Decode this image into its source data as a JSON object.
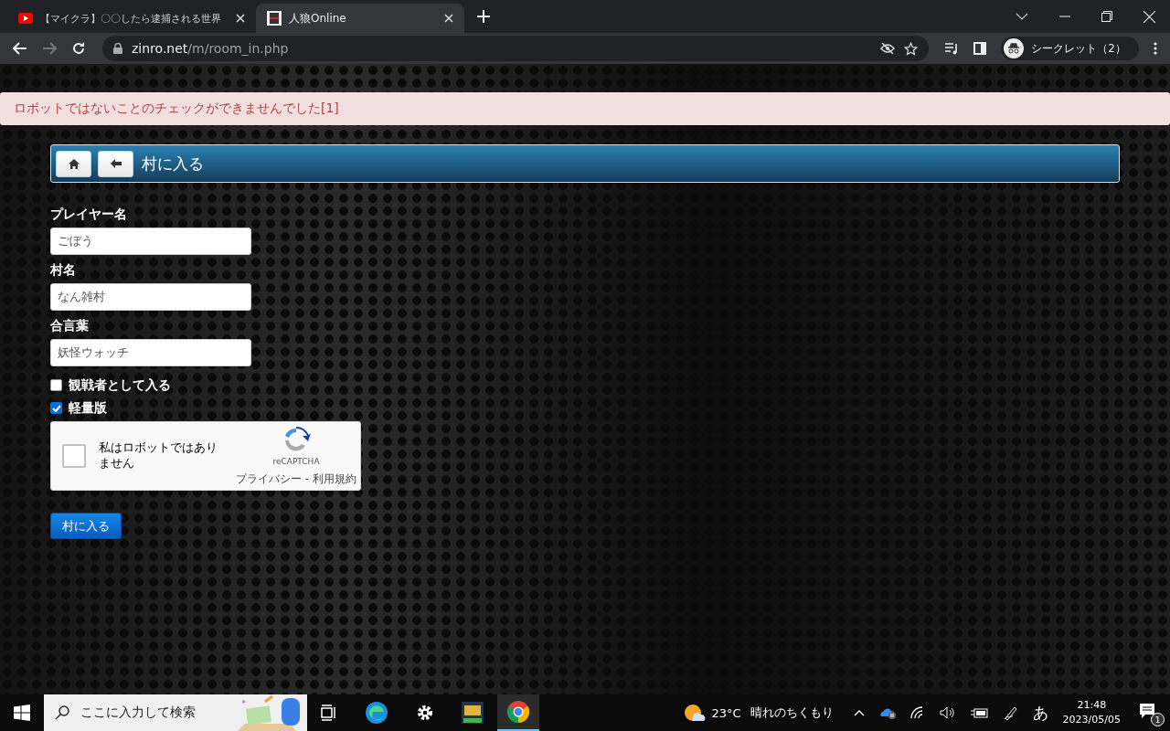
{
  "browser": {
    "tabs": [
      {
        "title": "【マイクラ】〇〇したら逮捕される世界",
        "selected": false
      },
      {
        "title": "人狼Online",
        "selected": true
      }
    ],
    "url": {
      "host": "zinro.net",
      "path": "/m/room_in.php"
    },
    "profile": "シークレット（2）"
  },
  "alert": "ロボットではないことのチェックができませんでした[1]",
  "header": {
    "title": "村に入る"
  },
  "fields": [
    {
      "label": "プレイヤー名",
      "value": "ごぼう"
    },
    {
      "label": "村名",
      "value": "なん雑村"
    },
    {
      "label": "合言葉",
      "value": "妖怪ウォッチ"
    }
  ],
  "checkboxes": [
    {
      "label": "観戦者として入る",
      "checked": false
    },
    {
      "label": "軽量版",
      "checked": true
    }
  ],
  "recaptcha": {
    "checked": false,
    "label": "私はロボットではありません",
    "brand": "reCAPTCHA",
    "links": [
      "プライバシー",
      "利用規約"
    ],
    "separator": "-"
  },
  "submit": "村に入る",
  "taskbar": {
    "search_placeholder": "ここに入力して検索",
    "temperature": "23°C",
    "weather": "晴れのちくもり",
    "ime": "あ",
    "time": "21:48",
    "date": "2023/05/05",
    "notifications": "1"
  }
}
